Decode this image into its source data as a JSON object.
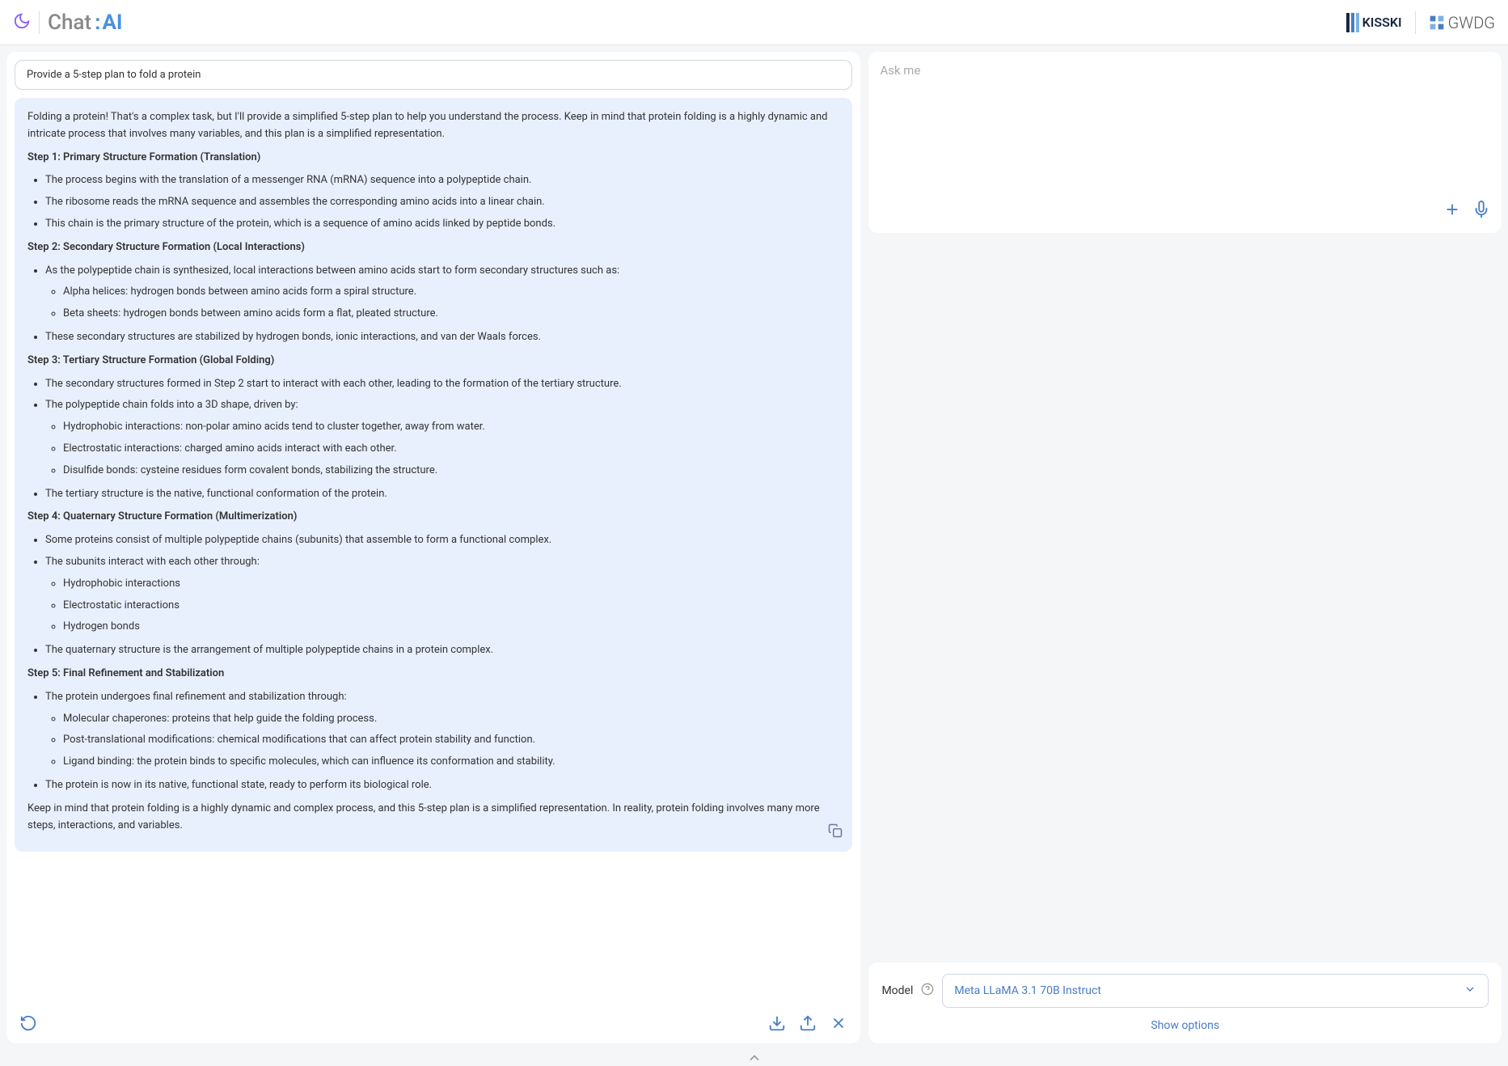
{
  "header": {
    "logo_text": "Chat",
    "logo_ai": "AI",
    "partner1": "KISSKI",
    "partner2": "GWDG"
  },
  "chat": {
    "user_message": "Provide a 5-step plan to fold a protein",
    "assistant": {
      "intro": "Folding a protein! That's a complex task, but I'll provide a simplified 5-step plan to help you understand the process. Keep in mind that protein folding is a highly dynamic and intricate process that involves many variables, and this plan is a simplified representation.",
      "step1_title": "Step 1: Primary Structure Formation (Translation)",
      "step1_items": [
        "The process begins with the translation of a messenger RNA (mRNA) sequence into a polypeptide chain.",
        "The ribosome reads the mRNA sequence and assembles the corresponding amino acids into a linear chain.",
        "This chain is the primary structure of the protein, which is a sequence of amino acids linked by peptide bonds."
      ],
      "step2_title": "Step 2: Secondary Structure Formation (Local Interactions)",
      "step2_item1": "As the polypeptide chain is synthesized, local interactions between amino acids start to form secondary structures such as:",
      "step2_sub": [
        "Alpha helices: hydrogen bonds between amino acids form a spiral structure.",
        "Beta sheets: hydrogen bonds between amino acids form a flat, pleated structure."
      ],
      "step2_item2": "These secondary structures are stabilized by hydrogen bonds, ionic interactions, and van der Waals forces.",
      "step3_title": "Step 3: Tertiary Structure Formation (Global Folding)",
      "step3_item1": "The secondary structures formed in Step 2 start to interact with each other, leading to the formation of the tertiary structure.",
      "step3_item2": "The polypeptide chain folds into a 3D shape, driven by:",
      "step3_sub": [
        "Hydrophobic interactions: non-polar amino acids tend to cluster together, away from water.",
        "Electrostatic interactions: charged amino acids interact with each other.",
        "Disulfide bonds: cysteine residues form covalent bonds, stabilizing the structure."
      ],
      "step3_item3": "The tertiary structure is the native, functional conformation of the protein.",
      "step4_title": "Step 4: Quaternary Structure Formation (Multimerization)",
      "step4_item1": "Some proteins consist of multiple polypeptide chains (subunits) that assemble to form a functional complex.",
      "step4_item2": "The subunits interact with each other through:",
      "step4_sub": [
        "Hydrophobic interactions",
        "Electrostatic interactions",
        "Hydrogen bonds"
      ],
      "step4_item3": "The quaternary structure is the arrangement of multiple polypeptide chains in a protein complex.",
      "step5_title": "Step 5: Final Refinement and Stabilization",
      "step5_item1": "The protein undergoes final refinement and stabilization through:",
      "step5_sub": [
        "Molecular chaperones: proteins that help guide the folding process.",
        "Post-translational modifications: chemical modifications that can affect protein stability and function.",
        "Ligand binding: the protein binds to specific molecules, which can influence its conformation and stability."
      ],
      "step5_item2": "The protein is now in its native, functional state, ready to perform its biological role.",
      "outro": "Keep in mind that protein folding is a highly dynamic and complex process, and this 5-step plan is a simplified representation. In reality, protein folding involves many more steps, interactions, and variables."
    }
  },
  "input": {
    "placeholder": "Ask me"
  },
  "model": {
    "label": "Model",
    "selected": "Meta LLaMA 3.1 70B Instruct",
    "show_options": "Show options"
  }
}
